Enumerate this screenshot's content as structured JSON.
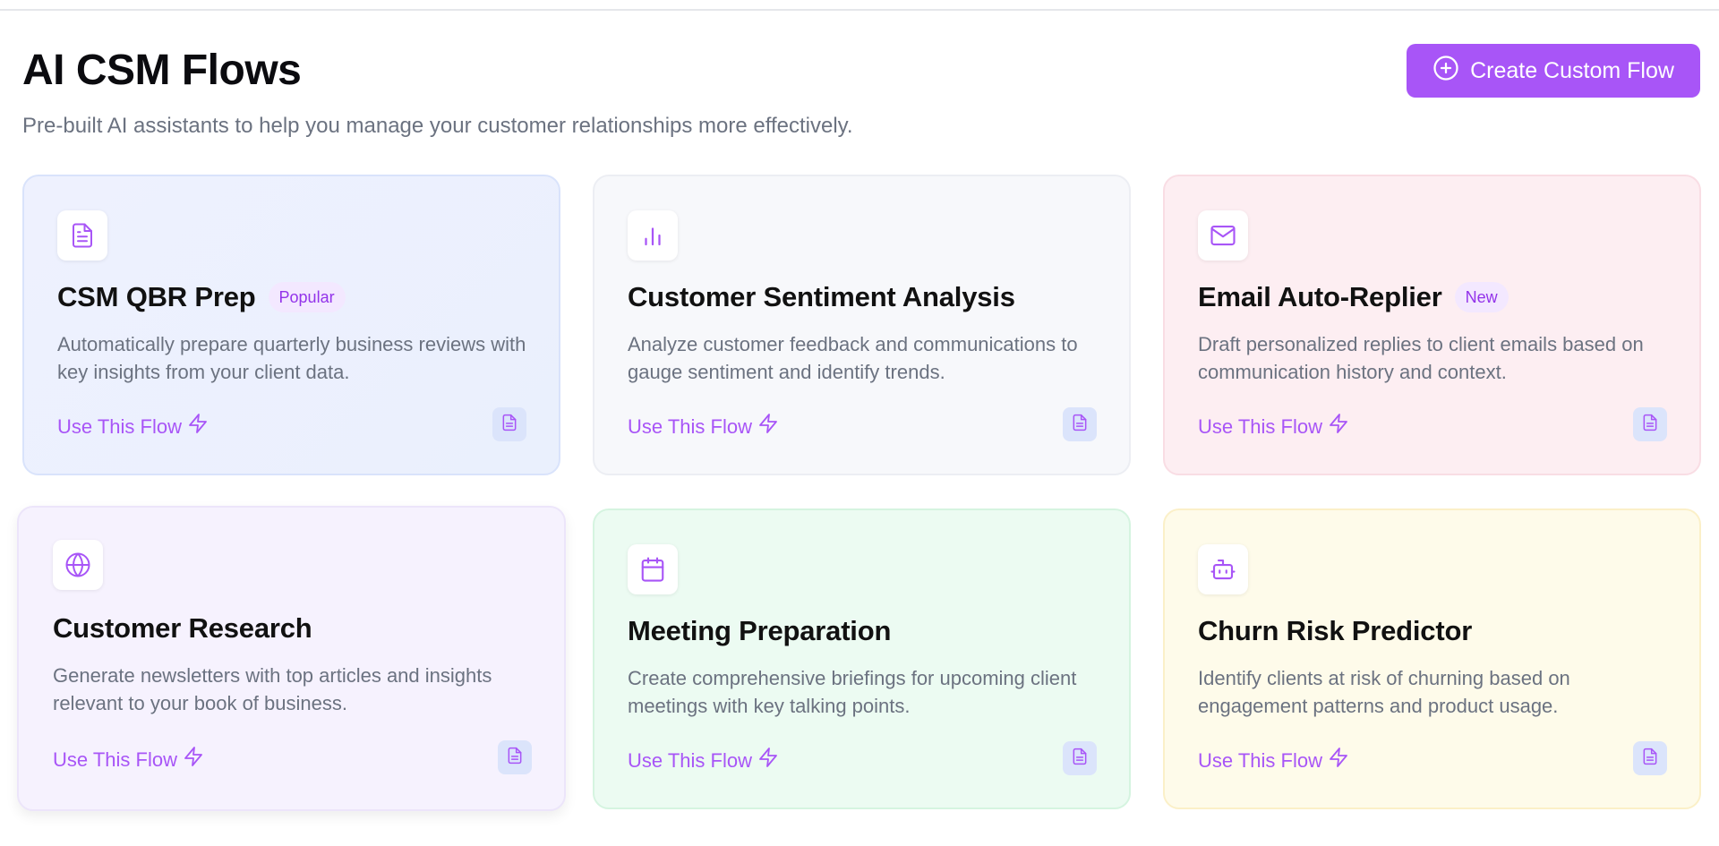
{
  "header": {
    "title": "AI CSM Flows",
    "subtitle": "Pre-built AI assistants to help you manage your customer relationships more effectively.",
    "create_button_label": "Create Custom Flow"
  },
  "cards": [
    {
      "icon": "document-icon",
      "title": "CSM QBR Prep",
      "badge": "Popular",
      "description": "Automatically prepare quarterly business reviews with key insights from your client data.",
      "action_label": "Use This Flow"
    },
    {
      "icon": "bar-chart-icon",
      "title": "Customer Sentiment Analysis",
      "badge": "",
      "description": "Analyze customer feedback and communications to gauge sentiment and identify trends.",
      "action_label": "Use This Flow"
    },
    {
      "icon": "mail-icon",
      "title": "Email Auto-Replier",
      "badge": "New",
      "description": "Draft personalized replies to client emails based on communication history and context.",
      "action_label": "Use This Flow"
    },
    {
      "icon": "globe-icon",
      "title": "Customer Research",
      "badge": "",
      "description": "Generate newsletters with top articles and insights relevant to your book of business.",
      "action_label": "Use This Flow"
    },
    {
      "icon": "calendar-icon",
      "title": "Meeting Preparation",
      "badge": "",
      "description": "Create comprehensive briefings for upcoming client meetings with key talking points.",
      "action_label": "Use This Flow"
    },
    {
      "icon": "bot-icon",
      "title": "Churn Risk Predictor",
      "badge": "",
      "description": "Identify clients at risk of churning based on engagement patterns and product usage.",
      "action_label": "Use This Flow"
    }
  ],
  "colors": {
    "accent": "#a855f7",
    "badge_bg": "#f3e8ff",
    "doc_button_bg": "#dbe4fb"
  }
}
